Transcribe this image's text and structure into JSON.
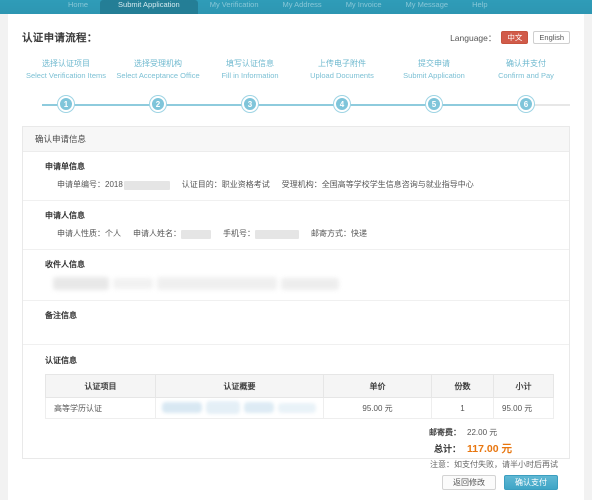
{
  "topnav": {
    "items": [
      {
        "label": "Home",
        "active": false
      },
      {
        "label": "Submit Application",
        "active": true
      },
      {
        "label": "My Verification",
        "active": false
      },
      {
        "label": "My Address",
        "active": false
      },
      {
        "label": "My Invoice",
        "active": false
      },
      {
        "label": "My Message",
        "active": false
      },
      {
        "label": "Help",
        "active": false
      }
    ]
  },
  "header": {
    "flow_title": "认证申请流程：",
    "language_label": "Language：",
    "lang_zh": "中文",
    "lang_en": "English",
    "accent_red": "#d15b4a",
    "accent_teal": "#3fa5c6",
    "step_color": "#7fc5da"
  },
  "stepper": {
    "steps": [
      {
        "num": "1",
        "cn": "选择认证项目",
        "en": "Select Verification Items"
      },
      {
        "num": "2",
        "cn": "选择受理机构",
        "en": "Select Acceptance Office"
      },
      {
        "num": "3",
        "cn": "填写认证信息",
        "en": "Fill in Information"
      },
      {
        "num": "4",
        "cn": "上传电子附件",
        "en": "Upload Documents"
      },
      {
        "num": "5",
        "cn": "提交申请",
        "en": "Submit Application"
      },
      {
        "num": "6",
        "cn": "确认并支付",
        "en": "Confirm and Pay"
      }
    ]
  },
  "card": {
    "head": "确认申请信息",
    "order": {
      "title": "申请单信息",
      "no_label": "申请单编号：",
      "no_value": "2018",
      "purpose_label": "认证目的：",
      "purpose_value": "职业资格考试",
      "office_label": "受理机构：",
      "office_value": "全国高等学校学生信息咨询与就业指导中心"
    },
    "applicant": {
      "title": "申请人信息",
      "type_label": "申请人性质：",
      "type_value": "个人",
      "name_label": "申请人姓名：",
      "name_value": "",
      "phone_label": "手机号：",
      "phone_value": "",
      "mail_label": "邮寄方式：",
      "mail_value": "快递"
    },
    "recipient": {
      "title": "收件人信息"
    },
    "remark": {
      "title": "备注信息"
    }
  },
  "verification": {
    "title": "认证信息",
    "columns": [
      "认证项目",
      "认证概要",
      "单价",
      "份数",
      "小计"
    ],
    "rows": [
      {
        "item": "高等学历认证",
        "summary": "",
        "price": "95.00 元",
        "qty": "1",
        "subtotal": "95.00 元"
      }
    ],
    "shipping_label": "邮寄费：",
    "shipping_value": "22.00 元",
    "total_label": "总计：",
    "total_value": "117.00 元",
    "total_color": "#e8760f"
  },
  "footer": {
    "note": "注意：如支付失败，请半小时后再试",
    "back_label": "返回修改",
    "pay_label": "确认支付"
  }
}
